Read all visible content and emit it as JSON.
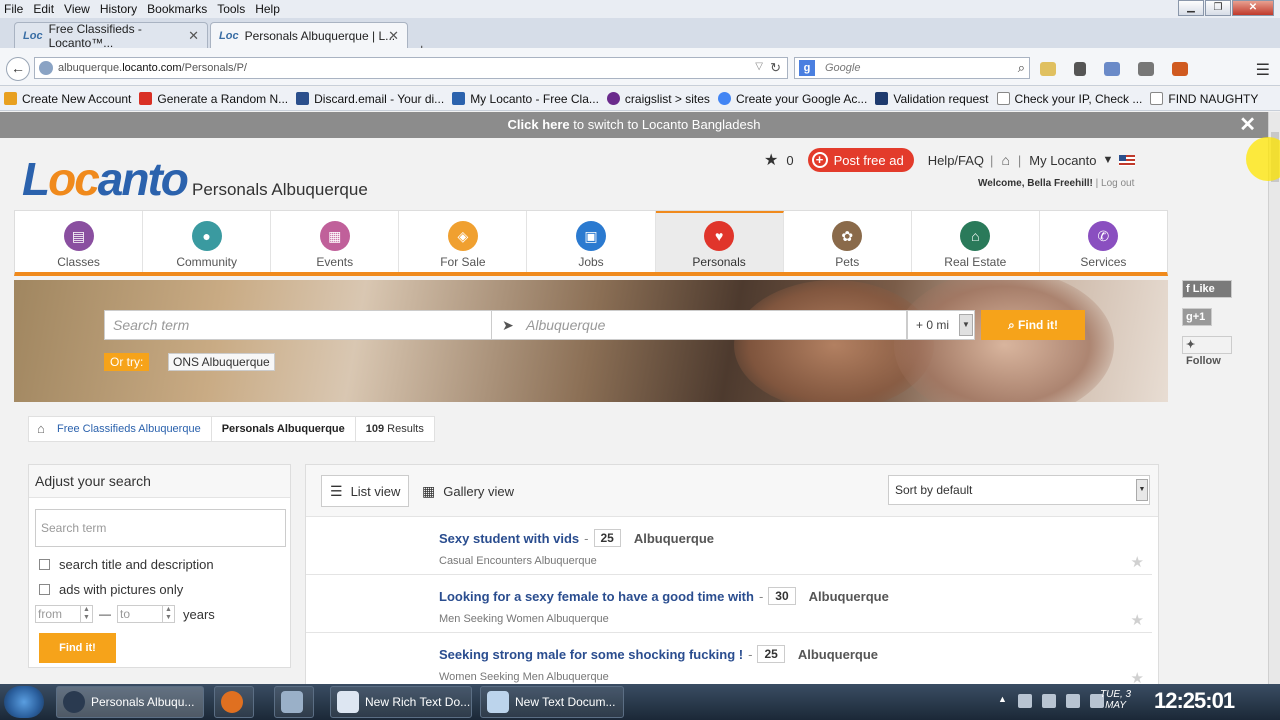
{
  "browser": {
    "menu": [
      "File",
      "Edit",
      "View",
      "History",
      "Bookmarks",
      "Tools",
      "Help"
    ],
    "tabs": [
      {
        "label": "Free Classifieds - Locanto™..."
      },
      {
        "label": "Personals Albuquerque | L..."
      }
    ],
    "url_prefix": "albuquerque.",
    "url_domain": "locanto.com",
    "url_path": "/Personals/P/",
    "search_placeholder": "Google",
    "bookmarks": [
      {
        "label": "Create New Account",
        "color": "#e8a020"
      },
      {
        "label": "Generate a Random N...",
        "color": "#d93025"
      },
      {
        "label": "Discard.email - Your di...",
        "color": "#2b4f8c"
      },
      {
        "label": "My Locanto - Free Cla...",
        "color": "#2b62ad"
      },
      {
        "label": "craigslist > sites",
        "color": "#6a2a8c"
      },
      {
        "label": "Create your Google Ac...",
        "color": "#4285f4"
      },
      {
        "label": "Validation request",
        "color": "#1e3a6e"
      },
      {
        "label": "Check your IP, Check ...",
        "color": "#ffffff"
      },
      {
        "label": "FIND NAUGHTY",
        "color": "#ffffff"
      }
    ]
  },
  "banner": {
    "link": "Click here",
    "text": " to switch to Locanto Bangladesh"
  },
  "header": {
    "logo_a": "L",
    "logo_b": "oc",
    "logo_c": "anto",
    "subtitle": "Personals Albuquerque",
    "fav_count": "0",
    "post_label": "Post free ad",
    "help": "Help/FAQ",
    "sep": "|",
    "my_locanto": "My Locanto",
    "welcome": "Welcome, Bella Freehill!",
    "logout": "Log out"
  },
  "categories": [
    {
      "label": "Classes",
      "color": "#8a4fa0",
      "icon": "classes-icon"
    },
    {
      "label": "Community",
      "color": "#3a9aa0",
      "icon": "community-icon"
    },
    {
      "label": "Events",
      "color": "#c0609a",
      "icon": "events-icon"
    },
    {
      "label": "For Sale",
      "color": "#f0a030",
      "icon": "tag-icon"
    },
    {
      "label": "Jobs",
      "color": "#2b7ad0",
      "icon": "briefcase-icon"
    },
    {
      "label": "Personals",
      "color": "#e0352b",
      "icon": "heart-icon"
    },
    {
      "label": "Pets",
      "color": "#8a6a4a",
      "icon": "paw-icon"
    },
    {
      "label": "Real Estate",
      "color": "#2a7a5a",
      "icon": "house-icon"
    },
    {
      "label": "Services",
      "color": "#8a4fc0",
      "icon": "phone-icon"
    }
  ],
  "search": {
    "term_placeholder": "Search term",
    "location_placeholder": "Albuquerque",
    "distance": "+ 0 mi",
    "find": "Find it!",
    "or_try": "Or try:",
    "suggestion": "ONS Albuquerque"
  },
  "social": {
    "like": "Like",
    "gplus": "+1",
    "follow": "Follow"
  },
  "breadcrumb": {
    "home": "Free Classifieds Albuquerque",
    "current": "Personals Albuquerque",
    "count": "109",
    "results": " Results"
  },
  "adjust": {
    "title": "Adjust your search",
    "placeholder": "Search term",
    "opt1": "search title and description",
    "opt2": "ads with pictures only",
    "from": "from",
    "dash": "—",
    "to": "to",
    "years": "years",
    "find": "Find it!"
  },
  "listing": {
    "list_view": "List view",
    "gallery_view": "Gallery view",
    "sort": "Sort by default",
    "items": [
      {
        "title": "Sexy student with vids",
        "age": "25",
        "location": "Albuquerque",
        "category": "Casual Encounters Albuquerque"
      },
      {
        "title": "Looking for a sexy female to have a good time with",
        "age": "30",
        "location": "Albuquerque",
        "category": "Men Seeking Women Albuquerque"
      },
      {
        "title": "Seeking strong male for some shocking fucking !",
        "age": "25",
        "location": "Albuquerque",
        "category": "Women Seeking Men Albuquerque"
      }
    ]
  },
  "taskbar": {
    "apps": [
      {
        "label": "Personals Albuqu..."
      },
      {
        "label": "New Rich Text Do..."
      },
      {
        "label": "New Text Docum..."
      }
    ],
    "day": "TUE, 3",
    "month": "MAY",
    "time": "12:25:01"
  }
}
